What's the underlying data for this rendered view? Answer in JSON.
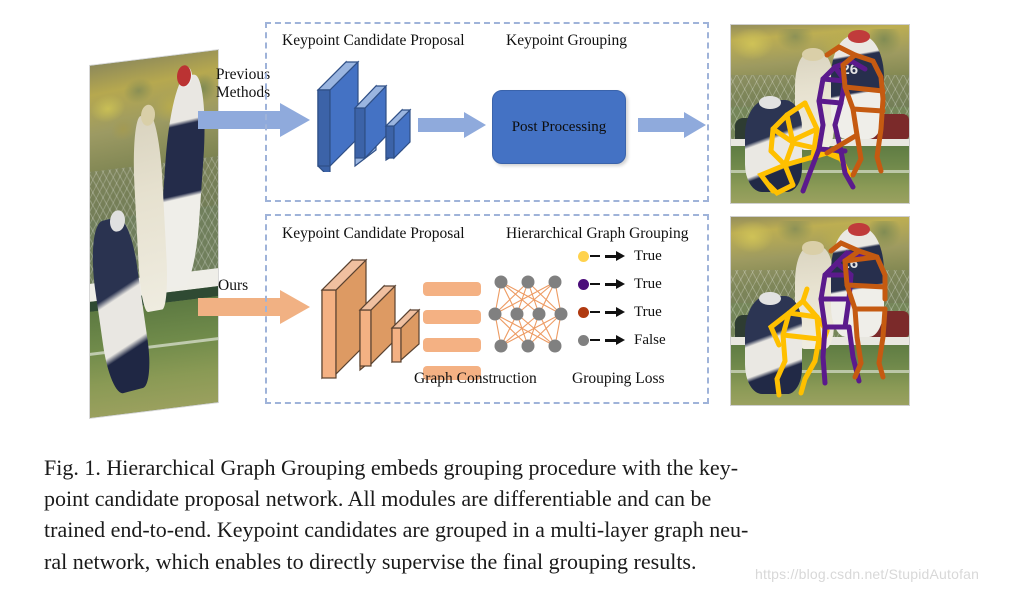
{
  "figure": {
    "flow_labels": {
      "previous": "Previous\nMethods",
      "previous_line1": "Previous",
      "previous_line2": "Methods",
      "ours": "Ours"
    },
    "top_panel": {
      "heading_left": "Keypoint Candidate Proposal",
      "heading_right": "Keypoint Grouping",
      "box_label": "Post Processing"
    },
    "bottom_panel": {
      "heading_left": "Keypoint Candidate Proposal",
      "heading_right": "Hierarchical Graph Grouping",
      "footer_left": "Graph Construction",
      "footer_right": "Grouping Loss",
      "legend": [
        {
          "dot_color": "#ffd24d",
          "label": "True"
        },
        {
          "dot_color": "#4b0d7a",
          "label": "True"
        },
        {
          "dot_color": "#b03a10",
          "label": "True"
        },
        {
          "dot_color": "#808080",
          "label": "False"
        }
      ]
    },
    "network": {
      "gnn_layer_node_counts": [
        3,
        4,
        3
      ],
      "feature_bar_count": 4
    },
    "colors": {
      "panel_border": "#9fb3d9",
      "blue_arrow": "#8faadc",
      "orange_arrow": "#f1b183",
      "blue_block": "#4472c4",
      "orange_block": "#ed9b63",
      "bar_orange": "#f4b183",
      "gnn_node": "#808080",
      "gnn_edge": "#ed9b63",
      "skeleton_yellow": "#ffc000",
      "skeleton_purple": "#5b1a8c",
      "skeleton_orange": "#c55a11"
    }
  },
  "caption": {
    "line1": "Fig. 1. Hierarchical Graph Grouping embeds grouping procedure with the key-",
    "line2": "point candidate proposal network. All modules are differentiable and can be",
    "line3": "trained end-to-end. Keypoint candidates are grouped in a multi-layer graph neu-",
    "line4": "ral network, which enables to directly supervise the final grouping results.",
    "full": "Fig. 1. Hierarchical Graph Grouping embeds grouping procedure with the keypoint candidate proposal network. All modules are differentiable and can be trained end-to-end. Keypoint candidates are grouped in a multi-layer graph neural network, which enables to directly supervise the final grouping results."
  },
  "watermark": {
    "text": "https://blog.csdn.net/StupidAutofan"
  }
}
